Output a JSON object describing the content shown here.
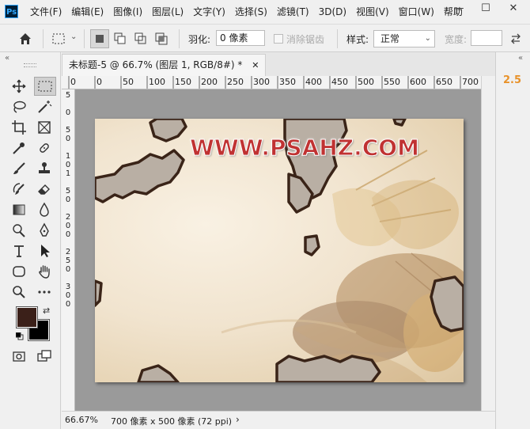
{
  "app": {
    "logo": "Ps"
  },
  "menu": [
    "文件(F)",
    "编辑(E)",
    "图像(I)",
    "图层(L)",
    "文字(Y)",
    "选择(S)",
    "滤镜(T)",
    "3D(D)",
    "视图(V)",
    "窗口(W)",
    "帮助"
  ],
  "window_controls": {
    "minimize": "—",
    "maximize": "☐",
    "close": "✕"
  },
  "options": {
    "feather_label": "羽化:",
    "feather_value": "0 像素",
    "antialias_label": "消除锯齿",
    "style_label": "样式:",
    "style_value": "正常",
    "width_label": "宽度:"
  },
  "document": {
    "tab_title": "未标题-5 @ 66.7% (图层 1, RGB/8#) *",
    "watermark_text": "WWW.PSAHZ.COM"
  },
  "rulers": {
    "horizontal_ticks": [
      "0",
      "0",
      "50",
      "100",
      "150",
      "200",
      "250",
      "300",
      "350",
      "400",
      "450",
      "500",
      "550",
      "600",
      "650",
      "700"
    ],
    "vertical_ticks": [
      "5",
      "0",
      "5",
      "0",
      "1",
      "0",
      "1",
      "5",
      "0",
      "2",
      "0",
      "0",
      "2",
      "5",
      "0",
      "3",
      "0",
      "0"
    ]
  },
  "status": {
    "zoom": "66.67%",
    "doc_info": "700 像素 x 500 像素 (72 ppi)",
    "arrow": "›"
  },
  "right_panel": {
    "readout": "2.5"
  },
  "colors": {
    "foreground": "#3b2019",
    "background": "#000000",
    "accent": "#31a8ff",
    "watermark": "#c03232"
  }
}
